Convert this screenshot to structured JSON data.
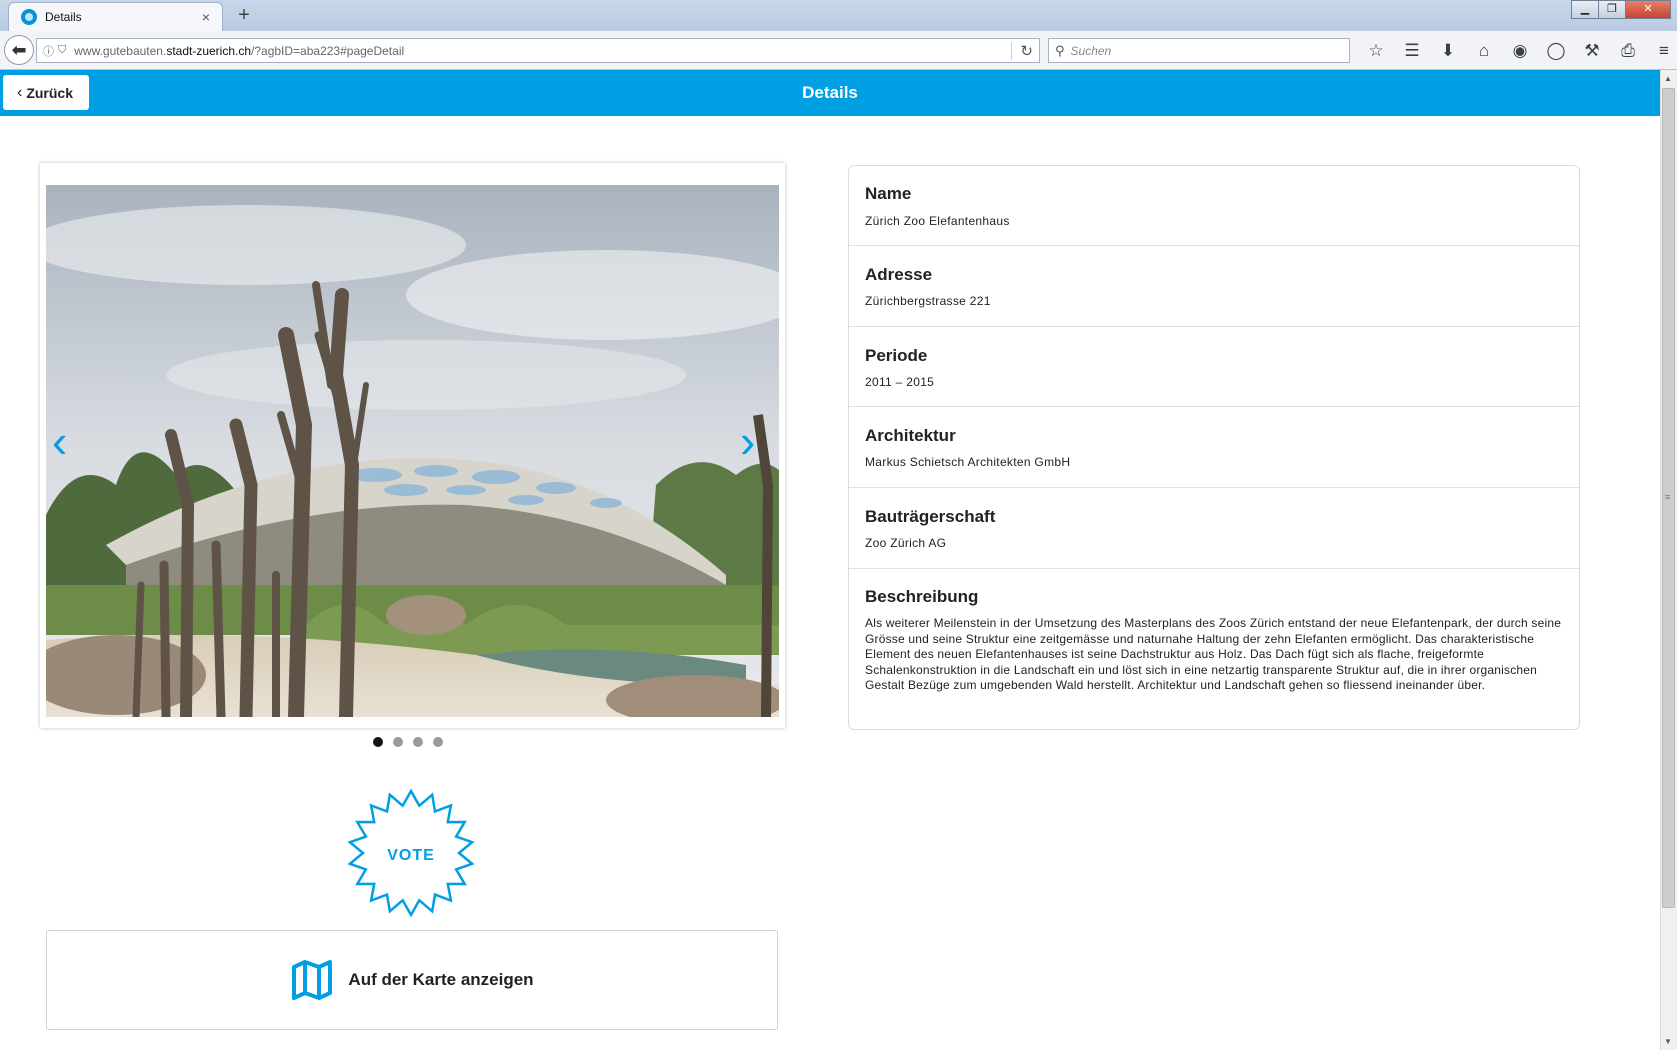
{
  "browser": {
    "tab_title": "Details",
    "tab_close": "×",
    "new_tab": "+",
    "url_domain_pre": "www.gutebauten.",
    "url_domain_main": "stadt-zuerich.ch",
    "url_path": "/?agbID=aba223#pageDetail",
    "search_placeholder": "Suchen"
  },
  "app": {
    "title": "Details",
    "back_label": "Zurück"
  },
  "slider": {
    "dot_count": 4,
    "active_dot": 0
  },
  "vote_label": "VOTE",
  "map_button_label": "Auf der Karte anzeigen",
  "details": {
    "name_label": "Name",
    "name_value": "Zürich Zoo Elefantenhaus",
    "address_label": "Adresse",
    "address_value": "Zürichbergstrasse 221",
    "period_label": "Periode",
    "period_value": "2011 – 2015",
    "architecture_label": "Architektur",
    "architecture_value": "Markus Schietsch Architekten GmbH",
    "developer_label": "Bauträgerschaft",
    "developer_value": "Zoo Zürich AG",
    "description_label": "Beschreibung",
    "description_value": "Als weiterer Meilenstein in der Umsetzung des Masterplans des Zoos Zürich entstand der neue Elefantenpark, der durch seine Grösse und seine Struktur eine zeitgemässe und naturnahe Haltung der zehn Elefanten ermöglicht. Das charakteristische Element des neuen Elefantenhauses ist seine Dachstruktur aus Holz. Das Dach fügt sich als flache, freigeformte Schalenkonstruktion in die Landschaft ein und löst sich in eine netzartig transparente Struktur auf, die in ihrer organischen Gestalt Bezüge zum umgebenden Wald herstellt. Architektur und Landschaft gehen so fliessend ineinander über."
  },
  "colors": {
    "accent": "#009fe3"
  }
}
